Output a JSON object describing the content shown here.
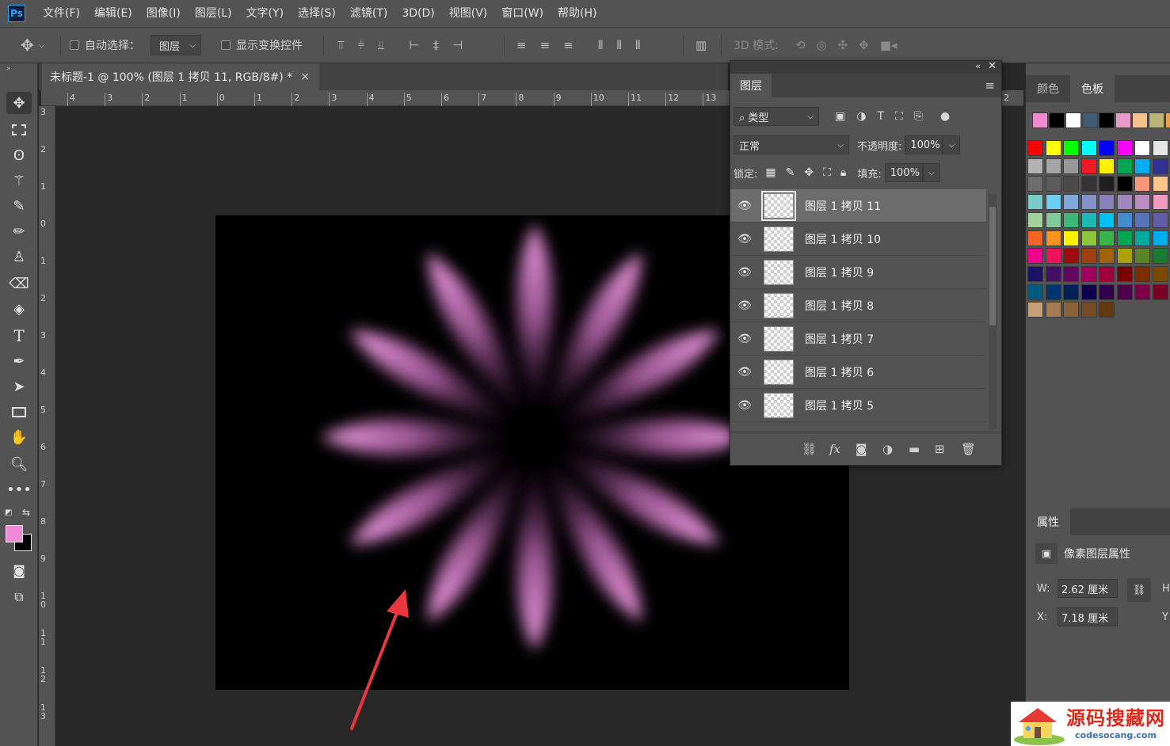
{
  "app": {
    "logo": "Ps"
  },
  "menu": [
    "文件(F)",
    "编辑(E)",
    "图像(I)",
    "图层(L)",
    "文字(Y)",
    "选择(S)",
    "滤镜(T)",
    "3D(D)",
    "视图(V)",
    "窗口(W)",
    "帮助(H)"
  ],
  "options": {
    "auto_select_label": "自动选择：",
    "auto_select_target": "图层",
    "show_transform_label": "显示变换控件",
    "mode_3d_label": "3D 模式:"
  },
  "document": {
    "tab_title": "未标题-1 @ 100% (图层 1 拷贝 11, RGB/8#) *",
    "close_glyph": "×"
  },
  "rulers": {
    "top": [
      "4",
      "3",
      "2",
      "1",
      "0",
      "1",
      "2",
      "3",
      "4",
      "5",
      "6",
      "7",
      "8",
      "9",
      "10",
      "11",
      "12",
      "13",
      "2"
    ],
    "left": [
      "3",
      "2",
      "1",
      "0",
      "1",
      "2",
      "3",
      "4",
      "5",
      "6",
      "7",
      "8",
      "9",
      "10",
      "11",
      "12",
      "13"
    ]
  },
  "canvas": {
    "petal_color": "#e58ad6",
    "background": "#000000",
    "petal_count": 12
  },
  "layers_panel": {
    "tab_label": "图层",
    "filter_label": "类型",
    "blend_mode": "正常",
    "opacity_label": "不透明度:",
    "opacity_value": "100%",
    "lock_label": "锁定:",
    "fill_label": "填充:",
    "fill_value": "100%",
    "layers": [
      {
        "name": "图层 1 拷贝 11",
        "active": true
      },
      {
        "name": "图层 1 拷贝 10",
        "active": false
      },
      {
        "name": "图层 1 拷贝 9",
        "active": false
      },
      {
        "name": "图层 1 拷贝 8",
        "active": false
      },
      {
        "name": "图层 1 拷贝 7",
        "active": false
      },
      {
        "name": "图层 1 拷贝 6",
        "active": false
      },
      {
        "name": "图层 1 拷贝 5",
        "active": false
      }
    ]
  },
  "swatches_panel": {
    "tab_color": "颜色",
    "tab_swatches": "色板",
    "recent": [
      "#f28ad2",
      "#000000",
      "#ffffff",
      "#3f5a73",
      "#000000",
      "#e59ac8",
      "#f2c28a",
      "#b8b47a",
      "#e8a050"
    ],
    "grid": [
      [
        "#ff0000",
        "#ffff00",
        "#00ff00",
        "#00ffff",
        "#0000ff",
        "#ff00ff",
        "#ffffff",
        "#e6e6e6"
      ],
      [
        "#b3b3b3",
        "#a6a6a6",
        "#999999",
        "#ed1c24",
        "#fff200",
        "#00a651",
        "#00aeef",
        "#2e3192"
      ],
      [
        "#6d6d6d",
        "#5c5c5c",
        "#4a4a4a",
        "#333333",
        "#1f1f1f",
        "#000000",
        "#f7977a",
        "#fdc68a"
      ],
      [
        "#7accc8",
        "#6dcff6",
        "#7da7d9",
        "#8393ca",
        "#8781bd",
        "#a187be",
        "#bc8dbf",
        "#f49ac1"
      ],
      [
        "#a3d39c",
        "#82ca9c",
        "#3cb878",
        "#1abbb4",
        "#00bff3",
        "#448ccb",
        "#5674b9",
        "#605ca8"
      ],
      [
        "#f26522",
        "#f7941d",
        "#fff200",
        "#8dc63f",
        "#39b54a",
        "#00a651",
        "#00a99d",
        "#00aeef"
      ],
      [
        "#ec008c",
        "#ed145b",
        "#9e0b0f",
        "#a0410d",
        "#a36209",
        "#aba000",
        "#598527",
        "#197b30"
      ],
      [
        "#1b1464",
        "#440e62",
        "#630460",
        "#9e005d",
        "#9e0039",
        "#790000",
        "#7b2e00",
        "#7d4900"
      ],
      [
        "#005b7f",
        "#003471",
        "#002157",
        "#0d004c",
        "#32004b",
        "#4b0049",
        "#7b0046",
        "#7a0026"
      ],
      [
        "#c7a078",
        "#a67c52",
        "#8c6239",
        "#754c24",
        "#603913"
      ]
    ]
  },
  "properties_panel": {
    "tab_label": "属性",
    "section_label": "像素图层属性",
    "w_label": "W:",
    "w_value": "2.62 厘米",
    "h_label": "H",
    "x_label": "X:",
    "x_value": "7.18 厘米",
    "y_label": "Y"
  },
  "watermark": {
    "title": "源码搜藏网",
    "url": "codesocang.com"
  },
  "annotation": {
    "arrow_color": "#e8383d"
  }
}
